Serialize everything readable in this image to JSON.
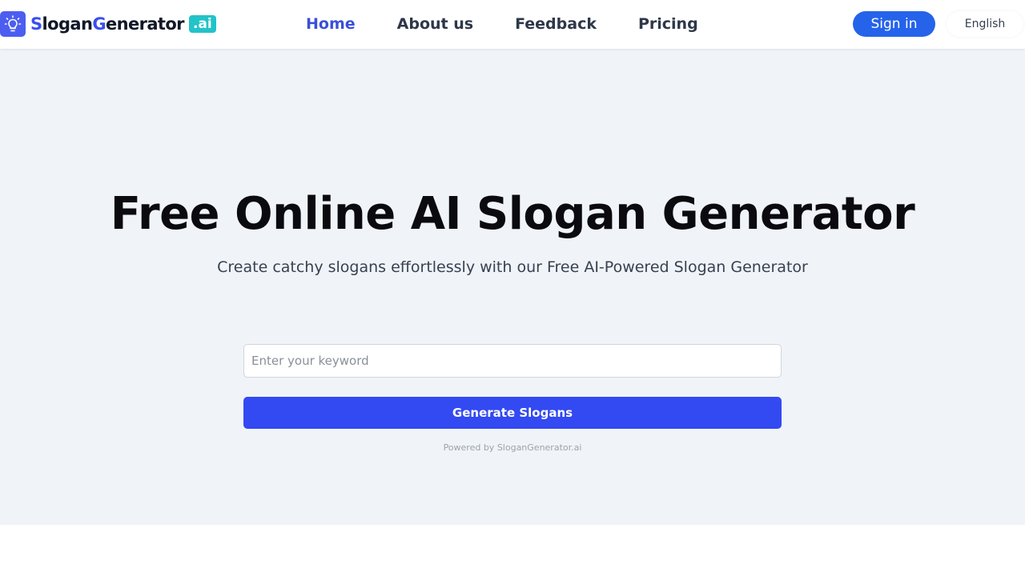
{
  "brand": {
    "name_part1": "S",
    "name_part2": "logan",
    "name_part3": "G",
    "name_part4": "enerator",
    "suffix": ".ai",
    "accent_color": "#3b4ef0",
    "suffix_color": "#22c3c9",
    "icon": "lightbulb-icon"
  },
  "nav": {
    "items": [
      {
        "label": "Home",
        "active": true
      },
      {
        "label": "About us",
        "active": false
      },
      {
        "label": "Feedback",
        "active": false
      },
      {
        "label": "Pricing",
        "active": false
      }
    ]
  },
  "header": {
    "signin_label": "Sign in",
    "language": "English"
  },
  "hero": {
    "title": "Free Online AI Slogan Generator",
    "subtitle": "Create catchy slogans effortlessly with our Free AI-Powered Slogan Generator",
    "input_placeholder": "Enter your keyword",
    "input_value": "",
    "generate_label": "Generate Slogans",
    "powered_by": "Powered by SloganGenerator.ai"
  },
  "colors": {
    "primary": "#2563eb",
    "generate_button": "#3349f2",
    "hero_background": "#f0f4f8"
  }
}
